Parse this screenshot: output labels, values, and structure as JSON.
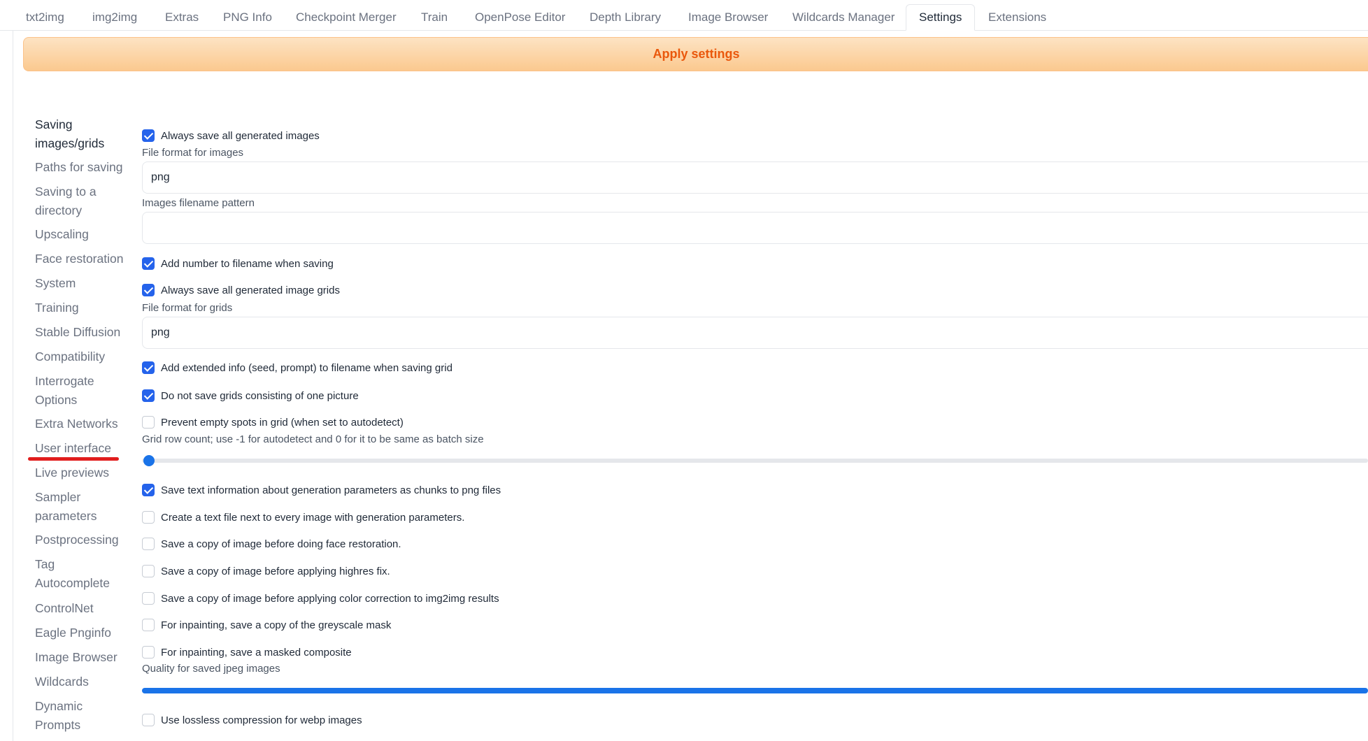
{
  "tabs": [
    {
      "label": "txt2img",
      "active": false
    },
    {
      "label": "img2img",
      "active": false
    },
    {
      "label": "Extras",
      "active": false
    },
    {
      "label": "PNG Info",
      "active": false
    },
    {
      "label": "Checkpoint Merger",
      "active": false
    },
    {
      "label": "Train",
      "active": false
    },
    {
      "label": "OpenPose Editor",
      "active": false
    },
    {
      "label": "Depth Library",
      "active": false
    },
    {
      "label": "Image Browser",
      "active": false
    },
    {
      "label": "Wildcards Manager",
      "active": false
    },
    {
      "label": "Settings",
      "active": true
    },
    {
      "label": "Extensions",
      "active": false
    }
  ],
  "apply_button": "Apply settings",
  "sidebar": [
    "Saving images/grids",
    "Paths for saving",
    "Saving to a directory",
    "Upscaling",
    "Face restoration",
    "System",
    "Training",
    "Stable Diffusion",
    "Compatibility",
    "Interrogate Options",
    "Extra Networks",
    "User interface",
    "Live previews",
    "Sampler parameters",
    "Postprocessing",
    "Tag Autocomplete",
    "ControlNet",
    "Eagle Pnginfo",
    "Image Browser",
    "Wildcards",
    "Dynamic Prompts"
  ],
  "settings": {
    "always_save_images": {
      "label": "Always save all generated images",
      "checked": true
    },
    "file_format_images": {
      "label": "File format for images",
      "value": "png"
    },
    "images_filename_pattern": {
      "label": "Images filename pattern",
      "value": ""
    },
    "add_number": {
      "label": "Add number to filename when saving",
      "checked": true
    },
    "always_save_grids": {
      "label": "Always save all generated image grids",
      "checked": true
    },
    "file_format_grids": {
      "label": "File format for grids",
      "value": "png"
    },
    "grid_extended_info": {
      "label": "Add extended info (seed, prompt) to filename when saving grid",
      "checked": true
    },
    "no_single_grids": {
      "label": "Do not save grids consisting of one picture",
      "checked": true
    },
    "prevent_empty_spots": {
      "label": "Prevent empty spots in grid (when set to autodetect)",
      "checked": false
    },
    "grid_row_count": {
      "label": "Grid row count; use -1 for autodetect and 0 for it to be same as batch size",
      "level": 0
    },
    "save_text_chunks": {
      "label": "Save text information about generation parameters as chunks to png files",
      "checked": true
    },
    "create_text_file": {
      "label": "Create a text file next to every image with generation parameters.",
      "checked": false
    },
    "copy_before_face": {
      "label": "Save a copy of image before doing face restoration.",
      "checked": false
    },
    "copy_before_highres": {
      "label": "Save a copy of image before applying highres fix.",
      "checked": false
    },
    "copy_before_color": {
      "label": "Save a copy of image before applying color correction to img2img results",
      "checked": false
    },
    "inpaint_greyscale_mask": {
      "label": "For inpainting, save a copy of the greyscale mask",
      "checked": false
    },
    "inpaint_masked_composite": {
      "label": "For inpainting, save a masked composite",
      "checked": false
    },
    "jpeg_quality": {
      "label": "Quality for saved jpeg images",
      "level": 1
    },
    "webp_lossless": {
      "label": "Use lossless compression for webp images",
      "checked": false
    }
  },
  "colors": {
    "accent": "#2563eb",
    "apply_text": "#ea580c",
    "underline": "#e11d1d"
  },
  "icons": {
    "checked": "check-icon"
  }
}
